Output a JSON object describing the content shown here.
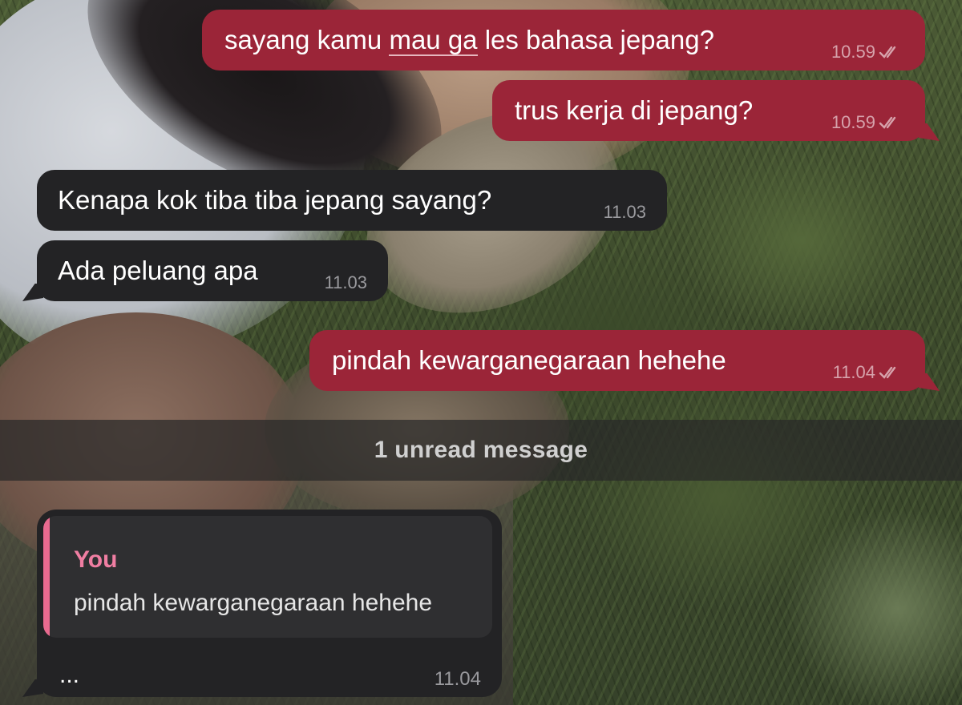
{
  "messages": [
    {
      "direction": "out",
      "text_before": "sayang kamu ",
      "text_underlined": "mau ga",
      "text_after": " les bahasa jepang?",
      "time": "10.59",
      "status": "read-double-check"
    },
    {
      "direction": "out",
      "text": "trus kerja di jepang?",
      "time": "10.59",
      "status": "read-double-check"
    },
    {
      "direction": "in",
      "text": "Kenapa kok tiba tiba jepang sayang?",
      "time": "11.03"
    },
    {
      "direction": "in",
      "text": "Ada peluang apa",
      "time": "11.03"
    },
    {
      "direction": "out",
      "text": "pindah kewarganegaraan hehehe",
      "time": "11.04",
      "status": "read-double-check"
    }
  ],
  "unread_divider": {
    "label": "1 unread message"
  },
  "reply_message": {
    "direction": "in",
    "quoted_author": "You",
    "quoted_text": "pindah kewarganegaraan hehehe",
    "text": "...",
    "time": "11.04"
  },
  "colors": {
    "outgoing_bubble": "#9b2538",
    "incoming_bubble": "#232325",
    "quote_accent": "#e86a8f",
    "unread_bar": "#282828"
  },
  "icons": {
    "read_receipt": "double-check-icon",
    "bubble_tail": "bubble-tail-icon"
  }
}
